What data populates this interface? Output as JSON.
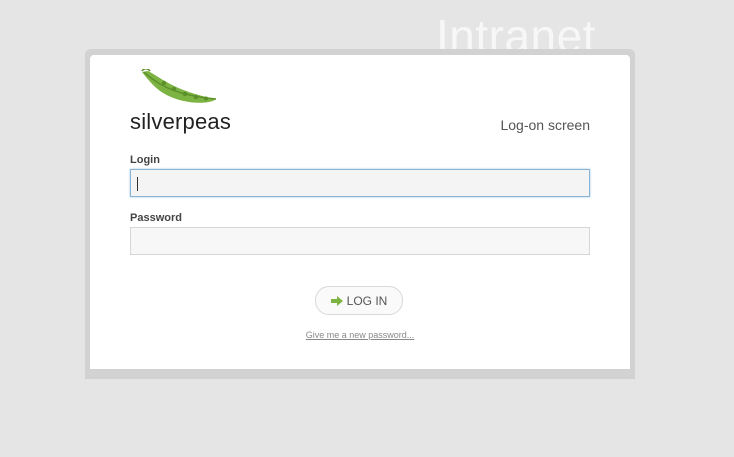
{
  "header": {
    "title": "Intranet"
  },
  "logo": {
    "wordmark": "silverpeas"
  },
  "panel": {
    "screen_label": "Log-on screen"
  },
  "form": {
    "login_label": "Login",
    "login_value": "",
    "password_label": "Password",
    "password_value": "",
    "submit_label": "LOG IN",
    "forgot_link": "Give me a new password..."
  },
  "colors": {
    "accent_green": "#7cb342",
    "background": "#e5e5e5"
  },
  "icons": {
    "submit": "arrow-right-icon",
    "logo": "pea-pod-icon"
  }
}
